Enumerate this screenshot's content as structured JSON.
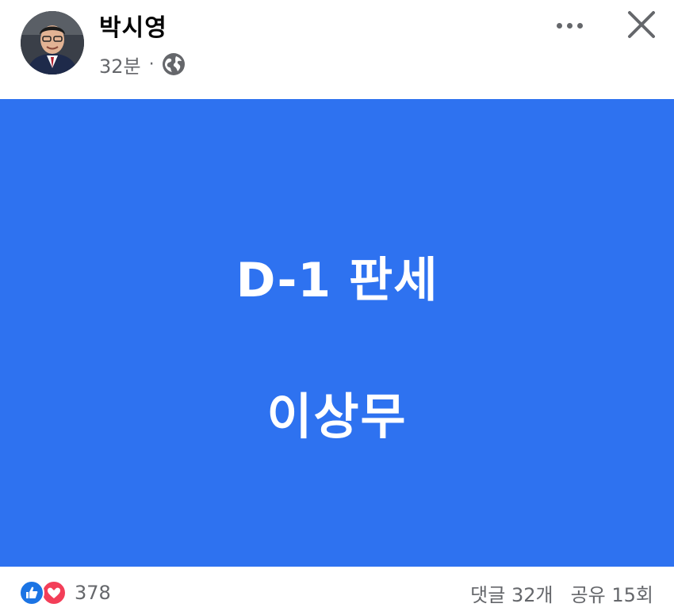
{
  "post": {
    "author": "박시영",
    "time": "32분",
    "separator": "·",
    "visibility_icon": "globe-icon",
    "menu_icon": "more-horizontal-icon",
    "close_icon": "close-icon",
    "image_lines": [
      "D-1 판세",
      "이상무"
    ],
    "image_background": "#2e72f0",
    "reactions": {
      "icons": [
        "like-icon",
        "love-icon"
      ],
      "count": "378"
    },
    "comments": "댓글 32개",
    "shares": "공유 15회"
  }
}
